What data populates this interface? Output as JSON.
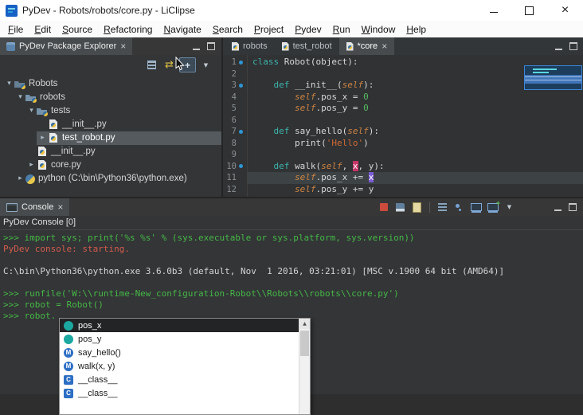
{
  "window": {
    "title": "PyDev - Robots/robots/core.py - LiClipse"
  },
  "menu": {
    "items": [
      "File",
      "Edit",
      "Source",
      "Refactoring",
      "Navigate",
      "Search",
      "Project",
      "Pydev",
      "Run",
      "Window",
      "Help"
    ]
  },
  "explorer": {
    "tab_label": "PyDev Package Explorer",
    "toolbar": [
      {
        "name": "collapse-all"
      },
      {
        "name": "link-with-editor"
      },
      {
        "name": "customize-view",
        "hover": true
      },
      {
        "name": "view-menu"
      }
    ],
    "tree": [
      {
        "label": "Robots",
        "depth": 0,
        "exp": "open",
        "icon": "project"
      },
      {
        "label": "robots",
        "depth": 1,
        "exp": "open",
        "icon": "package"
      },
      {
        "label": "tests",
        "depth": 2,
        "exp": "open",
        "icon": "package"
      },
      {
        "label": "__init__.py",
        "depth": 3,
        "exp": "none",
        "icon": "pyfile"
      },
      {
        "label": "test_robot.py",
        "depth": 3,
        "exp": "closed",
        "icon": "pyfile",
        "selected": true
      },
      {
        "label": "__init__.py",
        "depth": 2,
        "exp": "none",
        "icon": "pyfile"
      },
      {
        "label": "core.py",
        "depth": 2,
        "exp": "closed",
        "icon": "pyfile"
      },
      {
        "label": "python (C:\\bin\\Python36\\python.exe)",
        "depth": 1,
        "exp": "closed",
        "icon": "python"
      }
    ]
  },
  "editor": {
    "tabs": [
      {
        "label": "robots"
      },
      {
        "label": "test_robot"
      },
      {
        "label": "*core",
        "active": true,
        "close": true
      }
    ],
    "lines": [
      {
        "n": "1",
        "m": true,
        "s": [
          [
            "class",
            "kw"
          ],
          [
            " Robot(object):",
            "pl"
          ]
        ]
      },
      {
        "n": "2",
        "m": false,
        "s": []
      },
      {
        "n": "3",
        "m": true,
        "s": [
          [
            "    ",
            "pl"
          ],
          [
            "def",
            "kw"
          ],
          [
            " __init__(",
            "pl"
          ],
          [
            "self",
            "slf"
          ],
          [
            "):",
            "pl"
          ]
        ]
      },
      {
        "n": "4",
        "m": false,
        "s": [
          [
            "        ",
            "pl"
          ],
          [
            "self",
            "slf"
          ],
          [
            ".pos_x = ",
            "pl"
          ],
          [
            "0",
            "num"
          ]
        ]
      },
      {
        "n": "5",
        "m": false,
        "s": [
          [
            "        ",
            "pl"
          ],
          [
            "self",
            "slf"
          ],
          [
            ".pos_y = ",
            "pl"
          ],
          [
            "0",
            "num"
          ]
        ]
      },
      {
        "n": "6",
        "m": false,
        "s": []
      },
      {
        "n": "7",
        "m": true,
        "s": [
          [
            "    ",
            "pl"
          ],
          [
            "def",
            "kw"
          ],
          [
            " say_hello(",
            "pl"
          ],
          [
            "self",
            "slf"
          ],
          [
            "):",
            "pl"
          ]
        ]
      },
      {
        "n": "8",
        "m": false,
        "s": [
          [
            "        print(",
            "pl"
          ],
          [
            "'Hello'",
            "str"
          ],
          [
            ")",
            "pl"
          ]
        ]
      },
      {
        "n": "9",
        "m": false,
        "s": []
      },
      {
        "n": "10",
        "m": true,
        "s": [
          [
            "    ",
            "pl"
          ],
          [
            "def",
            "kw"
          ],
          [
            " walk(",
            "pl"
          ],
          [
            "self",
            "slf"
          ],
          [
            ", ",
            "pl"
          ],
          [
            "x",
            "occw"
          ],
          [
            ", y):",
            "pl"
          ]
        ]
      },
      {
        "n": "11",
        "m": false,
        "cur": true,
        "s": [
          [
            "        ",
            "pl"
          ],
          [
            "self",
            "slf"
          ],
          [
            ".pos_x += ",
            "pl"
          ],
          [
            "x",
            "occs"
          ]
        ]
      },
      {
        "n": "12",
        "m": false,
        "s": [
          [
            "        ",
            "pl"
          ],
          [
            "self",
            "slf"
          ],
          [
            ".pos_y += y",
            "pl"
          ]
        ]
      }
    ]
  },
  "console": {
    "tab_label": "Console",
    "sublabel": "PyDev Console [0]",
    "toolbar": [
      {
        "name": "terminate-console"
      },
      {
        "name": "save-console-output"
      },
      {
        "name": "clear-console"
      },
      {
        "name": "separator"
      },
      {
        "name": "scroll-lock"
      },
      {
        "name": "pin-console"
      },
      {
        "name": "display-selected-console"
      },
      {
        "name": "open-console"
      },
      {
        "name": "console-view-menu"
      }
    ],
    "lines": [
      {
        "t": ">>> import sys; print('%s %s' % (sys.executable or sys.platform, sys.version))",
        "c": "in"
      },
      {
        "t": "PyDev console: starting.",
        "c": "err"
      },
      {
        "t": "",
        "c": "out"
      },
      {
        "t": "C:\\bin\\Python36\\python.exe 3.6.0b3 (default, Nov  1 2016, 03:21:01) [MSC v.1900 64 bit (AMD64)]",
        "c": "out"
      },
      {
        "t": "",
        "c": "out"
      },
      {
        "t": ">>> runfile('W:\\\\runtime-New_configuration-Robot\\\\Robots\\\\robots\\\\core.py')",
        "c": "in"
      },
      {
        "t": ">>> robot = Robot()",
        "c": "in"
      },
      {
        "t": ">>> robot.",
        "c": "in"
      }
    ]
  },
  "autocomplete": {
    "items": [
      {
        "label": "pos_x",
        "icon": "field",
        "selected": true
      },
      {
        "label": "pos_y",
        "icon": "field"
      },
      {
        "label": "say_hello()",
        "icon": "method"
      },
      {
        "label": "walk(x, y)",
        "icon": "method"
      },
      {
        "label": "__class__",
        "icon": "class"
      },
      {
        "label": "__class__",
        "icon": "class"
      }
    ]
  },
  "icons": {
    "close": "×",
    "view-menu": "▼",
    "link-with-editor": "⇄",
    "twistie-open": "▾",
    "twistie-closed": "▸",
    "definition-marker": "blue-dot"
  },
  "colors": {
    "kw": "#3db3ab",
    "self": "#cd8442",
    "str": "#cf6a34",
    "num": "#55b85f",
    "plain": "#d8d8d8",
    "occw": "#c73667",
    "occs": "#7a5bd6",
    "cin": "#46b846",
    "cerr": "#d45c4c",
    "cout": "#d4d4d4",
    "accent": "#3e86d9"
  }
}
